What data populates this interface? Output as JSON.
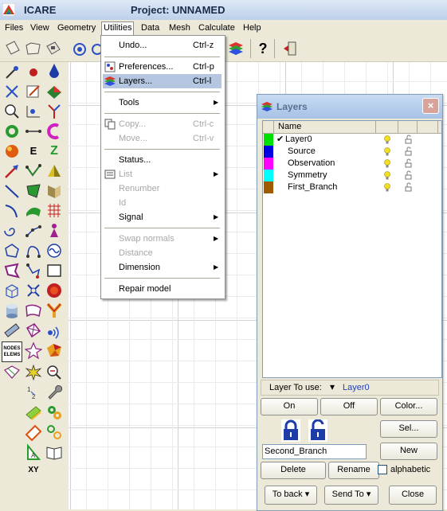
{
  "window": {
    "app_title": "ICARE",
    "project_title": "Project: UNNAMED",
    "buttons": {
      "minimize": "_",
      "maximize": "□",
      "close": "×"
    }
  },
  "menubar": {
    "items": [
      "Files",
      "View",
      "Geometry",
      "Utilities",
      "Data",
      "Mesh",
      "Calculate",
      "Help"
    ],
    "active": "Utilities"
  },
  "toolbar": {
    "icons": [
      "new-file-icon",
      "open-folder-icon",
      "save-disk-icon",
      "view-icon",
      "view-icon-2",
      "layers-icon",
      "help-question-icon",
      "exit-door-icon"
    ],
    "help_glyph": "?"
  },
  "utilities_menu": {
    "items": [
      {
        "label": "Undo...",
        "shortcut": "Ctrl-z",
        "enabled": true
      },
      {
        "label": "Preferences...",
        "shortcut": "Ctrl-p",
        "enabled": true,
        "icon": "preferences-icon"
      },
      {
        "label": "Layers...",
        "shortcut": "Ctrl-l",
        "enabled": true,
        "icon": "layers-icon",
        "highlighted": true
      },
      {
        "label": "Tools",
        "submenu": true,
        "enabled": true
      },
      {
        "label": "Copy...",
        "shortcut": "Ctrl-c",
        "enabled": false,
        "icon": "copy-icon"
      },
      {
        "label": "Move...",
        "shortcut": "Ctrl-v",
        "enabled": false
      },
      {
        "label": "Status...",
        "enabled": true
      },
      {
        "label": "List",
        "submenu": true,
        "enabled": false,
        "icon": "list-icon"
      },
      {
        "label": "Renumber",
        "enabled": false
      },
      {
        "label": "Id",
        "enabled": false
      },
      {
        "label": "Signal",
        "submenu": true,
        "enabled": true
      },
      {
        "label": "Swap normals",
        "submenu": true,
        "enabled": false
      },
      {
        "label": "Distance",
        "enabled": false
      },
      {
        "label": "Dimension",
        "submenu": true,
        "enabled": true
      },
      {
        "label": "Repair model",
        "enabled": true
      }
    ],
    "submenu_arrow": "▶"
  },
  "layers_panel": {
    "title": "Layers",
    "close_glyph": "×",
    "column_header": "Name",
    "layers": [
      {
        "name": "Layer0",
        "color": "#00e000",
        "checked": true
      },
      {
        "name": "Source",
        "color": "#0000e0",
        "checked": false
      },
      {
        "name": "Observation",
        "color": "#ff00ff",
        "checked": false
      },
      {
        "name": "Symmetry",
        "color": "#00ffff",
        "checked": false
      },
      {
        "name": "First_Branch",
        "color": "#a05a00",
        "checked": false
      }
    ],
    "check_glyph": "✔",
    "layer_to_use_label": "Layer To use:",
    "layer_to_use_value": "Layer0",
    "on_label": "On",
    "off_label": "Off",
    "color_label": "Color...",
    "sel_label": "Sel...",
    "new_layer_value": "Second_Branch",
    "new_label": "New",
    "delete_label": "Delete",
    "rename_label": "Rename",
    "alphabetic_label": "alphabetic",
    "to_back_label": "To back",
    "send_to_label": "Send To",
    "close_label": "Close",
    "dropdown_arrow": "▾"
  },
  "palette": {
    "labels": [
      "E",
      "Z",
      "NODES ELEMS",
      "XY"
    ]
  }
}
